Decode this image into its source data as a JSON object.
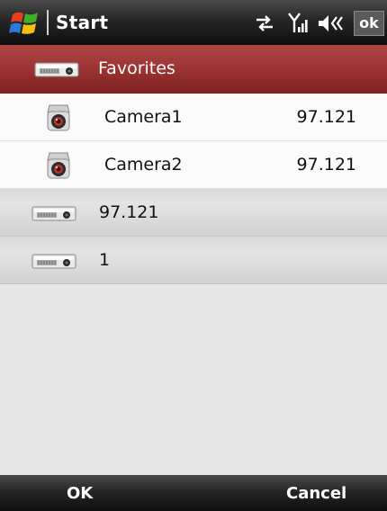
{
  "status_bar": {
    "title": "Start",
    "ok_label": "ok",
    "icons": [
      "windows-start-icon",
      "data-sync-icon",
      "signal-strength-icon",
      "speaker-icon"
    ]
  },
  "list": {
    "header": {
      "label": "Favorites",
      "icon": "dvr-icon"
    },
    "items": [
      {
        "name": "Camera1",
        "address": "97.121",
        "icon": "camera-icon"
      },
      {
        "name": "Camera2",
        "address": "97.121",
        "icon": "camera-icon"
      }
    ],
    "groups": [
      {
        "label": "97.121",
        "icon": "dvr-icon"
      },
      {
        "label": "1",
        "icon": "dvr-icon"
      }
    ]
  },
  "softkeys": {
    "left": "OK",
    "right": "Cancel"
  },
  "colors": {
    "header_red": "#983230",
    "bar_dark": "#1a1a1a",
    "group_gray": "#d8d8d8"
  }
}
